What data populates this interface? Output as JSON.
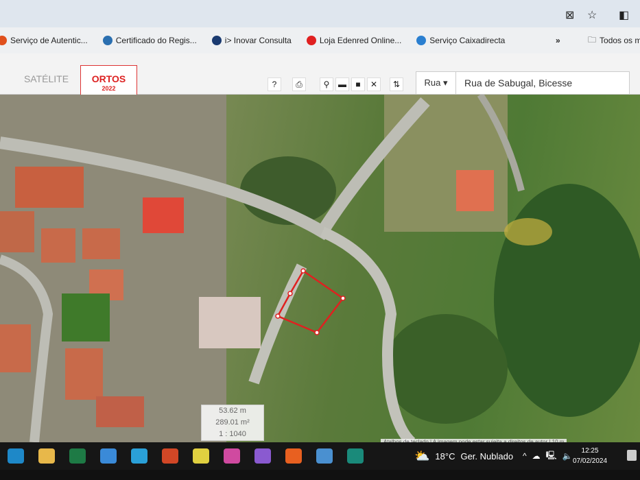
{
  "browser": {
    "icons": [
      "camera-off-icon",
      "star-icon",
      "sidebar-icon"
    ]
  },
  "bookmarks": {
    "items": [
      {
        "label": "Serviço de Autentic...",
        "color": "#e0501c"
      },
      {
        "label": "Certificado do Regis...",
        "color": "#2a6fb0"
      },
      {
        "label": "i> Inovar Consulta",
        "color": "#1a3a70"
      },
      {
        "label": "Loja Edenred Online...",
        "color": "#e02020"
      },
      {
        "label": "Serviço Caixadirecta",
        "color": "#2a7fd0"
      }
    ],
    "more": "»",
    "folder": "Todos os m"
  },
  "toolbar": {
    "tab_satellite": "SATÉLITE",
    "tab_ortos": "ORTOS",
    "tab_ortos_year": "2022",
    "tools": [
      "?",
      "⎙",
      "⚲",
      "▬",
      "■",
      "✕",
      "⇅"
    ],
    "search_type": "Rua ▾",
    "search_value": "Rua de Sabugal, Bicesse"
  },
  "map": {
    "distance": "53.62 m",
    "area": "289.01 m²",
    "scale": "1 : 1040",
    "attribution": "Atalhos de teclado | A imagem pode estar sujeita a direitos de autor | 10 m"
  },
  "taskbar": {
    "apps": [
      {
        "name": "edge-icon",
        "color": "#1e88c8"
      },
      {
        "name": "file-explorer-icon",
        "color": "#e8b84a"
      },
      {
        "name": "excel-icon",
        "color": "#1e7a45"
      },
      {
        "name": "mail-icon",
        "color": "#3a8ad8"
      },
      {
        "name": "edge-icon",
        "color": "#2aa0d8"
      },
      {
        "name": "powerpoint-icon",
        "color": "#d24726"
      },
      {
        "name": "chrome-icon",
        "color": "#e0d040"
      },
      {
        "name": "paint-icon",
        "color": "#d04aa0"
      },
      {
        "name": "media-icon",
        "color": "#8a5ad0"
      },
      {
        "name": "firefox-icon",
        "color": "#e86020"
      },
      {
        "name": "calculator-icon",
        "color": "#4a90d0"
      },
      {
        "name": "publisher-icon",
        "color": "#1a8a7a"
      }
    ],
    "weather_temp": "18°C",
    "weather_desc": "Ger. Nublado",
    "time": "12:25",
    "date": "07/02/2024"
  }
}
